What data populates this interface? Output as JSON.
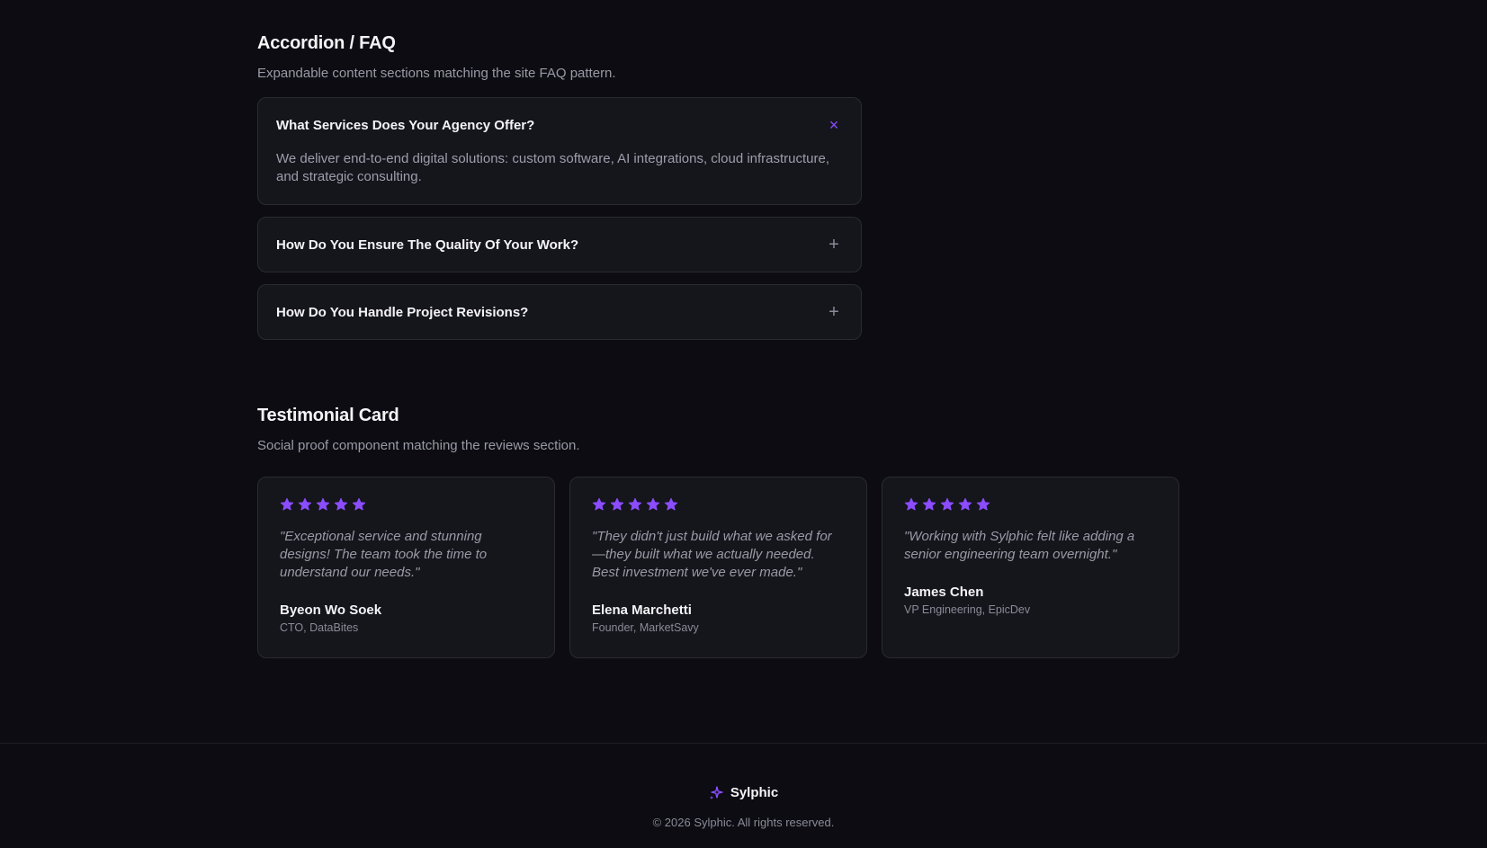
{
  "accordion_section": {
    "title": "Accordion / FAQ",
    "subtitle": "Expandable content sections matching the site FAQ pattern.",
    "items": [
      {
        "question": "What Services Does Your Agency Offer?",
        "answer": "We deliver end-to-end digital solutions: custom software, AI integrations, cloud infrastructure, and strategic consulting.",
        "expanded": true,
        "toggle_icon": "close-icon",
        "toggle_glyph": "×"
      },
      {
        "question": "How Do You Ensure The Quality Of Your Work?",
        "expanded": false,
        "toggle_icon": "plus-icon",
        "toggle_glyph": "+"
      },
      {
        "question": "How Do You Handle Project Revisions?",
        "expanded": false,
        "toggle_icon": "plus-icon",
        "toggle_glyph": "+"
      }
    ]
  },
  "testimonial_section": {
    "title": "Testimonial Card",
    "subtitle": "Social proof component matching the reviews section.",
    "cards": [
      {
        "rating": 5,
        "quote": "\"Exceptional service and stunning designs! The team took the time to understand our needs.\"",
        "name": "Byeon Wo Soek",
        "role": "CTO, DataBites"
      },
      {
        "rating": 5,
        "quote": "\"They didn't just build what we asked for—they built what we actually needed. Best investment we've ever made.\"",
        "name": "Elena Marchetti",
        "role": "Founder, MarketSavy"
      },
      {
        "rating": 5,
        "quote": "\"Working with Sylphic felt like adding a senior engineering team overnight.\"",
        "name": "James Chen",
        "role": "VP Engineering, EpicDev"
      }
    ]
  },
  "footer": {
    "brand": "Sylphic",
    "brand_icon": "sparkle-icon",
    "copyright": "© 2026 Sylphic. All rights reserved."
  },
  "colors": {
    "background": "#0c0c12",
    "card": "#15151c",
    "border": "#2a2a34",
    "accent": "#8b4dff",
    "star": "#8b4dff"
  }
}
